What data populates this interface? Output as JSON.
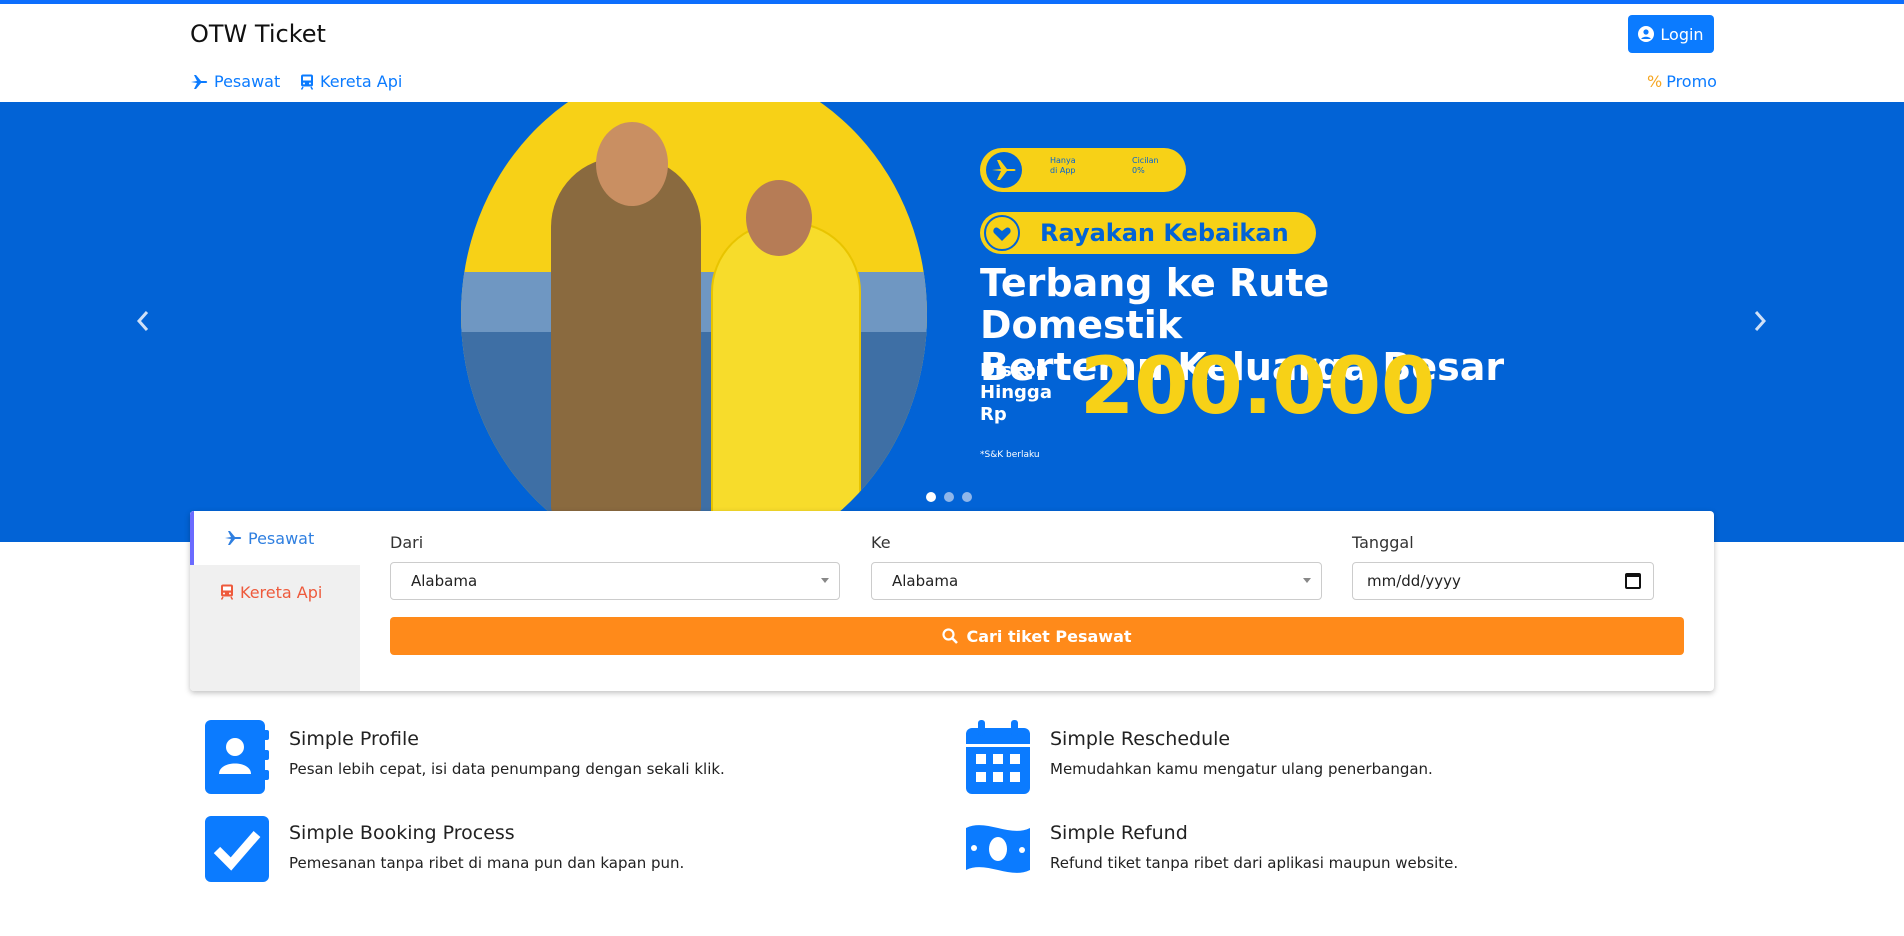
{
  "brand": "OTW Ticket",
  "login_label": "Login",
  "nav": {
    "pesawat": "Pesawat",
    "kereta": "Kereta Api",
    "promo_symbol": "%",
    "promo": "Promo"
  },
  "hero": {
    "badge1_line1": "Hanya di App",
    "badge1_line2": "Cicilan 0%",
    "tagline": "Rayakan Kebaikan",
    "headline_line1": "Terbang ke Rute Domestik",
    "headline_line2": "Bertemu Keluarga Besar",
    "discount_label_1": "Diskon",
    "discount_label_2": "Hingga",
    "discount_label_3": "Rp",
    "discount_value": "200.000",
    "terms": "*S&K berlaku",
    "slides": 3,
    "active_slide": 1
  },
  "search": {
    "tab_plane": "Pesawat",
    "tab_train": "Kereta Api",
    "from_label": "Dari",
    "from_value": "Alabama",
    "to_label": "Ke",
    "to_value": "Alabama",
    "date_label": "Tanggal",
    "date_placeholder": "mm/dd/yyyy",
    "button": "Cari tiket Pesawat"
  },
  "features": [
    {
      "title": "Simple Profile",
      "desc": "Pesan lebih cepat, isi data penumpang dengan sekali klik.",
      "icon": "contact-book-icon"
    },
    {
      "title": "Simple Reschedule",
      "desc": "Memudahkan kamu mengatur ulang penerbangan.",
      "icon": "calendar-icon"
    },
    {
      "title": "Simple Booking Process",
      "desc": "Pemesanan tanpa ribet di mana pun dan kapan pun.",
      "icon": "check-square-icon"
    },
    {
      "title": "Simple Refund",
      "desc": "Refund tiket tanpa ribet dari aplikasi maupun website.",
      "icon": "money-bill-icon"
    }
  ],
  "colors": {
    "primary": "#0b7bff",
    "hero_bg": "#0263d6",
    "accent_yellow": "#f7d117",
    "search_button": "#ff8a1a",
    "train_tab": "#ee5a3c"
  }
}
